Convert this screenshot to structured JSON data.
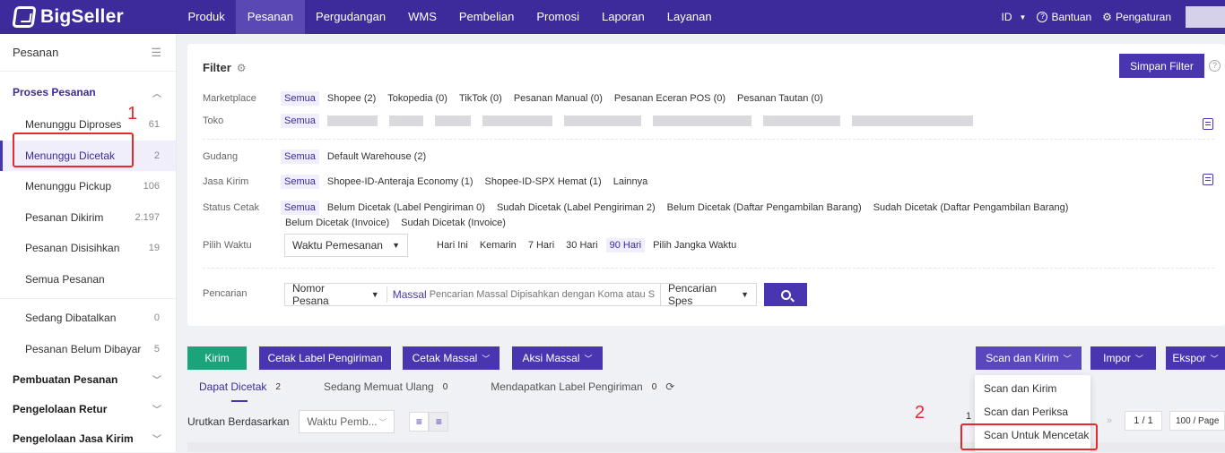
{
  "brand": {
    "name": "BigSeller"
  },
  "nav": {
    "items": [
      "Produk",
      "Pesanan",
      "Pergudangan",
      "WMS",
      "Pembelian",
      "Promosi",
      "Laporan",
      "Layanan"
    ],
    "active": "Pesanan"
  },
  "topright": {
    "lang": "ID",
    "help": "Bantuan",
    "settings": "Pengaturan"
  },
  "sidebar": {
    "title": "Pesanan",
    "section1": "Proses Pesanan",
    "items": [
      {
        "label": "Menunggu Diproses",
        "count": "61"
      },
      {
        "label": "Menunggu Dicetak",
        "count": "2"
      },
      {
        "label": "Menunggu Pickup",
        "count": "106"
      },
      {
        "label": "Pesanan Dikirim",
        "count": "2.197"
      },
      {
        "label": "Pesanan Disisihkan",
        "count": "19"
      },
      {
        "label": "Semua Pesanan",
        "count": ""
      },
      {
        "label": "Sedang Dibatalkan",
        "count": "0"
      },
      {
        "label": "Pesanan Belum Dibayar",
        "count": "5"
      }
    ],
    "sections": [
      "Pembuatan Pesanan",
      "Pengelolaan Retur",
      "Pengelolaan Jasa Kirim"
    ]
  },
  "filter": {
    "title": "Filter",
    "save": "Simpan Filter",
    "marketplace": {
      "label": "Marketplace",
      "options": [
        "Semua",
        "Shopee (2)",
        "Tokopedia (0)",
        "TikTok (0)",
        "Pesanan Manual (0)",
        "Pesanan Eceran POS (0)",
        "Pesanan Tautan (0)"
      ]
    },
    "toko": {
      "label": "Toko",
      "options": [
        "Semua"
      ]
    },
    "gudang": {
      "label": "Gudang",
      "options": [
        "Semua",
        "Default Warehouse (2)"
      ]
    },
    "jasa": {
      "label": "Jasa Kirim",
      "options": [
        "Semua",
        "Shopee-ID-Anteraja Economy (1)",
        "Shopee-ID-SPX Hemat (1)",
        "Lainnya"
      ]
    },
    "status": {
      "label": "Status Cetak",
      "options": [
        "Semua",
        "Belum Dicetak (Label Pengiriman 0)",
        "Sudah Dicetak (Label Pengiriman 2)",
        "Belum Dicetak (Daftar Pengambilan Barang)",
        "Sudah Dicetak (Daftar Pengambilan Barang)"
      ],
      "options2": [
        "Belum Dicetak (Invoice)",
        "Sudah Dicetak (Invoice)"
      ]
    },
    "waktu": {
      "label": "Pilih Waktu",
      "select": "Waktu Pemesanan",
      "options": [
        "Hari Ini",
        "Kemarin",
        "7 Hari",
        "30 Hari",
        "90 Hari",
        "Pilih Jangka Waktu"
      ],
      "selected": "90 Hari"
    },
    "search": {
      "label": "Pencarian",
      "type": "Nomor Pesana",
      "massal": "Massal",
      "placeholder": "Pencarian Massal Dipisahkan dengan Koma atau S",
      "spec": "Pencarian Spes"
    }
  },
  "actions": {
    "kirim": "Kirim",
    "cetak_label": "Cetak Label Pengiriman",
    "cetak_massal": "Cetak Massal",
    "aksi_massal": "Aksi Massal",
    "scan": "Scan dan Kirim",
    "impor": "Impor",
    "ekspor": "Ekspor"
  },
  "tabs": [
    {
      "label": "Dapat Dicetak",
      "count": "2"
    },
    {
      "label": "Sedang Memuat Ulang",
      "count": "0"
    },
    {
      "label": "Mendapatkan Label Pengiriman",
      "count": "0"
    }
  ],
  "sort": {
    "label": "Urutkan Berdasarkan",
    "select": "Waktu Pemb..."
  },
  "dropdown": {
    "items": [
      "Scan dan Kirim",
      "Scan dan Periksa",
      "Scan Untuk Mencetak"
    ]
  },
  "pager": {
    "prefix": "1",
    "page": "1 / 1",
    "size": "100 / Page"
  },
  "annotations": {
    "one": "1",
    "two": "2"
  },
  "colors": {
    "primary": "#4a35b0",
    "topbar": "#3d2a9b",
    "green": "#1ba37a",
    "annotation": "#e8282b"
  }
}
